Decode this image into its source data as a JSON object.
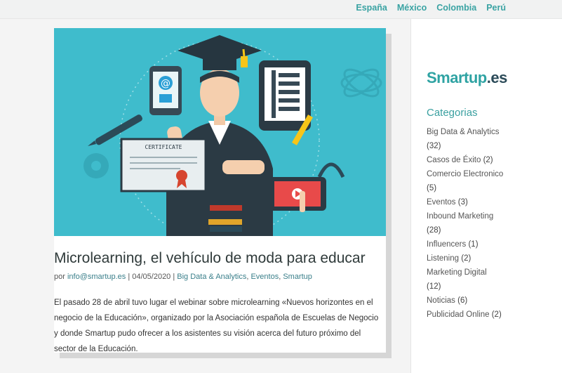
{
  "topnav": {
    "items": [
      {
        "label": "España"
      },
      {
        "label": "México"
      },
      {
        "label": "Colombia"
      },
      {
        "label": "Perú"
      }
    ]
  },
  "hero": {
    "certificate_text": "CERTIFICATE",
    "email_symbol": "@"
  },
  "post": {
    "title": "Microlearning, el vehículo de moda para educar",
    "meta_prefix": "por ",
    "author": "info@smartup.es",
    "date": " | 04/05/2020 | ",
    "categories": [
      {
        "label": "Big Data & Analytics"
      },
      {
        "label": "Eventos"
      },
      {
        "label": "Smartup"
      }
    ],
    "excerpt": "El pasado 28 de abril tuvo lugar el webinar sobre microlearning «Nuevos horizontes en el negocio de la Educación», organizado por la Asociación española de Escuelas de Negocio y donde Smartup pudo ofrecer a los asistentes su visión acerca del futuro próximo del sector de la Educación."
  },
  "sidebar": {
    "logo_a": "Smartup",
    "logo_b": ".es",
    "colors": {
      "brand": "#2fa3a3",
      "brand_dark": "#2b4a58"
    },
    "categories_title": "Categorias",
    "categories": [
      {
        "name": "Big Data & Analytics",
        "count": "(32)",
        "break": true
      },
      {
        "name": "Casos de Éxito",
        "count": "(2)",
        "break": false
      },
      {
        "name": "Comercio Electronico",
        "count": "(5)",
        "break": true
      },
      {
        "name": "Eventos",
        "count": "(3)",
        "break": false
      },
      {
        "name": "Inbound Marketing",
        "count": "(28)",
        "break": true
      },
      {
        "name": "Influencers",
        "count": "(1)",
        "break": false
      },
      {
        "name": "Listening",
        "count": "(2)",
        "break": false
      },
      {
        "name": "Marketing Digital",
        "count": "(12)",
        "break": true
      },
      {
        "name": "Noticias",
        "count": "(6)",
        "break": false
      },
      {
        "name": "Publicidad Online",
        "count": "(2)",
        "break": false
      }
    ]
  }
}
